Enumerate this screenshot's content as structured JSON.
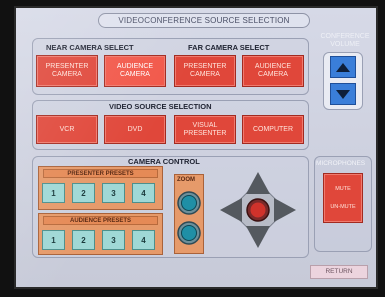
{
  "title": "VIDEOCONFERENCE SOURCE SELECTION",
  "near_camera": {
    "label": "NEAR CAMERA SELECT",
    "buttons": [
      "PRESENTER CAMERA",
      "AUDIENCE CAMERA"
    ]
  },
  "far_camera": {
    "label": "FAR CAMERA SELECT",
    "buttons": [
      "PRESENTER CAMERA",
      "AUDIENCE CAMERA"
    ]
  },
  "volume": {
    "label": "CONFERENCE VOLUME"
  },
  "video_source": {
    "label": "VIDEO SOURCE SELECTION",
    "buttons": [
      "VCR",
      "DVD",
      "VISUAL PRESENTER",
      "COMPUTER"
    ]
  },
  "camera_control": {
    "label": "CAMERA CONTROL",
    "presenter_presets": {
      "label": "PRESENTER PRESETS",
      "buttons": [
        "1",
        "2",
        "3",
        "4"
      ]
    },
    "audience_presets": {
      "label": "AUDIENCE PRESETS",
      "buttons": [
        "1",
        "2",
        "3",
        "4"
      ]
    },
    "zoom_label": "ZOOM"
  },
  "microphones": {
    "label": "MICROPHONES",
    "mute_label": "MUTE",
    "unmute_label": "UN-MUTE"
  },
  "return_label": "RETURN",
  "colors": {
    "accent_red": "#e0473a",
    "accent_teal": "#9fd8d6",
    "accent_blue": "#3a7ed9",
    "panel_orange": "#e69a6a"
  }
}
